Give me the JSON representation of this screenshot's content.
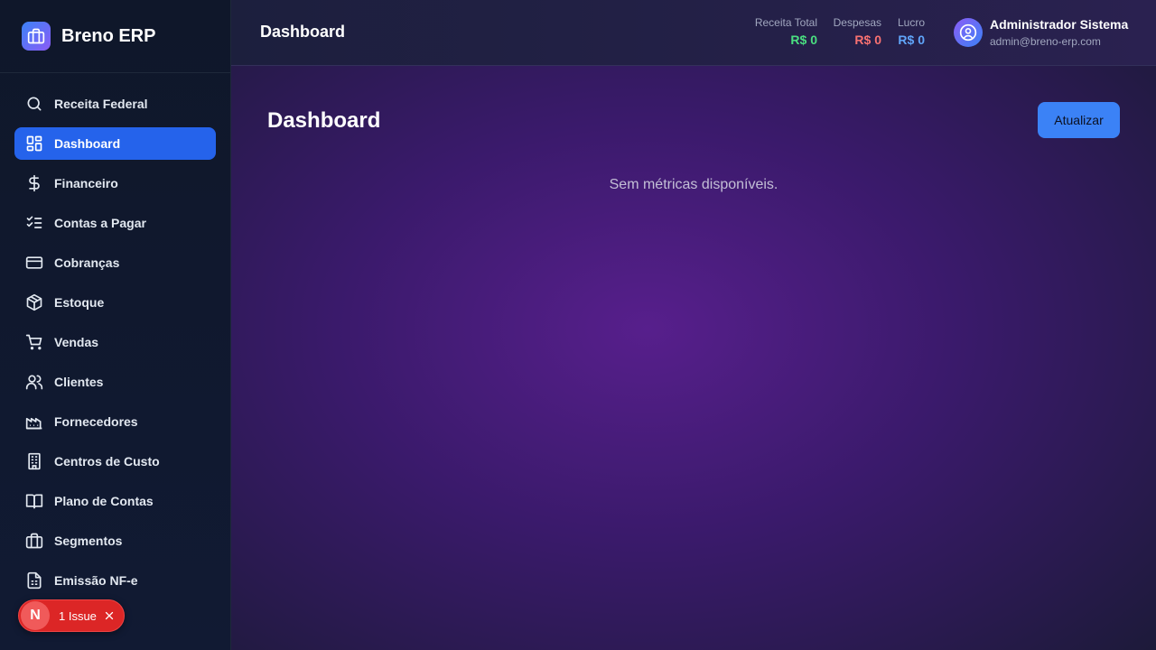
{
  "brand": {
    "name": "Breno ERP"
  },
  "sidebar": {
    "items": [
      {
        "label": "Receita Federal",
        "icon": "search-icon",
        "active": false
      },
      {
        "label": "Dashboard",
        "icon": "dashboard-icon",
        "active": true
      },
      {
        "label": "Financeiro",
        "icon": "dollar-icon",
        "active": false
      },
      {
        "label": "Contas a Pagar",
        "icon": "checklist-icon",
        "active": false
      },
      {
        "label": "Cobranças",
        "icon": "credit-card-icon",
        "active": false
      },
      {
        "label": "Estoque",
        "icon": "package-icon",
        "active": false
      },
      {
        "label": "Vendas",
        "icon": "cart-icon",
        "active": false
      },
      {
        "label": "Clientes",
        "icon": "users-icon",
        "active": false
      },
      {
        "label": "Fornecedores",
        "icon": "factory-icon",
        "active": false
      },
      {
        "label": "Centros de Custo",
        "icon": "building-icon",
        "active": false
      },
      {
        "label": "Plano de Contas",
        "icon": "book-icon",
        "active": false
      },
      {
        "label": "Segmentos",
        "icon": "briefcase-icon",
        "active": false
      },
      {
        "label": "Emissão NF-e",
        "icon": "file-icon",
        "active": false
      }
    ]
  },
  "issue_badge": {
    "logo": "N",
    "text": "1 Issue"
  },
  "header": {
    "title": "Dashboard",
    "metrics": {
      "receita": {
        "label": "Receita Total",
        "value": "R$ 0",
        "color": "#4ade80"
      },
      "despesas": {
        "label": "Despesas",
        "value": "R$ 0",
        "color": "#f87171"
      },
      "lucro": {
        "label": "Lucro",
        "value": "R$ 0",
        "color": "#60a5fa"
      }
    },
    "user": {
      "name": "Administrador Sistema",
      "email": "admin@breno-erp.com"
    }
  },
  "main": {
    "title": "Dashboard",
    "refresh_label": "Atualizar",
    "empty_message": "Sem métricas disponíveis."
  },
  "colors": {
    "accent": "#2563eb",
    "button": "#3b82f6",
    "positive": "#4ade80",
    "negative": "#f87171",
    "info": "#60a5fa"
  }
}
